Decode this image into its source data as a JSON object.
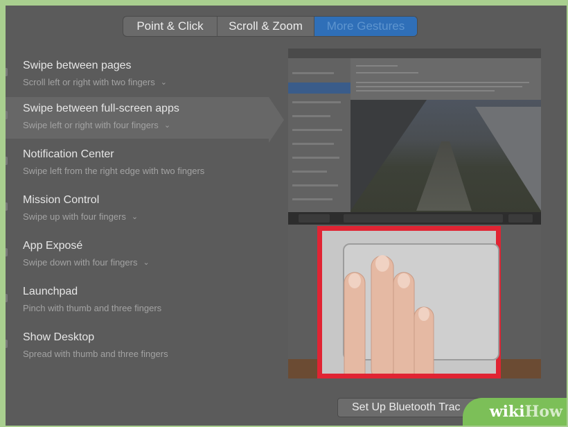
{
  "tabs": [
    {
      "label": "Point & Click"
    },
    {
      "label": "Scroll & Zoom"
    },
    {
      "label": "More Gestures",
      "selected": true
    }
  ],
  "gestures": [
    {
      "title": "Swipe between pages",
      "subtitle": "Scroll left or right with two fingers",
      "has_dropdown": true
    },
    {
      "title": "Swipe between full-screen apps",
      "subtitle": "Swipe left or right with four fingers",
      "has_dropdown": true,
      "selected": true
    },
    {
      "title": "Notification Center",
      "subtitle": "Swipe left from the right edge with two fingers",
      "has_dropdown": false
    },
    {
      "title": "Mission Control",
      "subtitle": "Swipe up with four fingers",
      "has_dropdown": true
    },
    {
      "title": "App Exposé",
      "subtitle": "Swipe down with four fingers",
      "has_dropdown": true
    },
    {
      "title": "Launchpad",
      "subtitle": "Pinch with thumb and three fingers",
      "has_dropdown": false
    },
    {
      "title": "Show Desktop",
      "subtitle": "Spread with thumb and three fingers",
      "has_dropdown": false
    }
  ],
  "bottom": {
    "setup_button": "Set Up Bluetooth Trac",
    "help_icon": "question-mark-icon"
  },
  "watermark": {
    "wiki": "wiki",
    "how": "How"
  },
  "colors": {
    "highlight": "#e02433",
    "selected_tab": "#2f6fb8",
    "watermark": "#7cbf58"
  }
}
